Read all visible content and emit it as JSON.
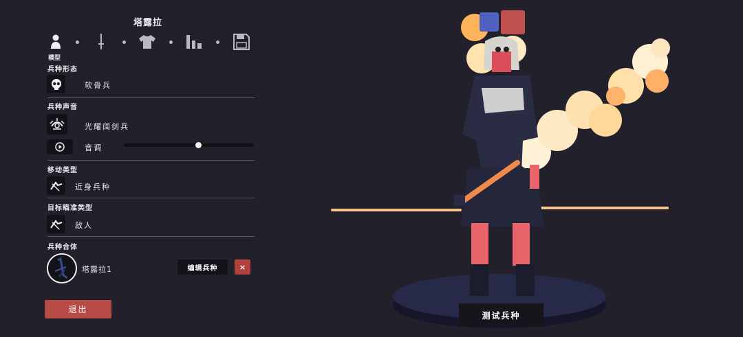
{
  "header": {
    "title": "塔露拉"
  },
  "tabs": {
    "active_caption": "模型",
    "items": [
      {
        "name": "model-icon"
      },
      {
        "name": "sword-icon"
      },
      {
        "name": "shirt-icon"
      },
      {
        "name": "stats-icon"
      },
      {
        "name": "save-icon"
      }
    ]
  },
  "sections": {
    "unit_form": {
      "label": "兵种形态",
      "value": "软骨兵"
    },
    "unit_voice": {
      "label": "兵种声音",
      "value": "光耀阔剑兵",
      "pitch_label": "音调",
      "pitch_level": 0.58
    },
    "movement": {
      "label": "移动类型",
      "value": "近身兵种"
    },
    "targeting": {
      "label": "目标瞄准类型",
      "value": "敌人"
    },
    "merge": {
      "label": "兵种合体",
      "unit_name": "塔露拉1",
      "edit_label": "编辑兵种",
      "remove_label": "×"
    }
  },
  "actions": {
    "exit_label": "退出",
    "test_label": "测试兵种"
  },
  "colors": {
    "background": "#22212b",
    "accent_red": "#b64a45",
    "swatch_blue": "#5061c2",
    "swatch_red": "#c05050",
    "flame": "#ffd9a0"
  }
}
